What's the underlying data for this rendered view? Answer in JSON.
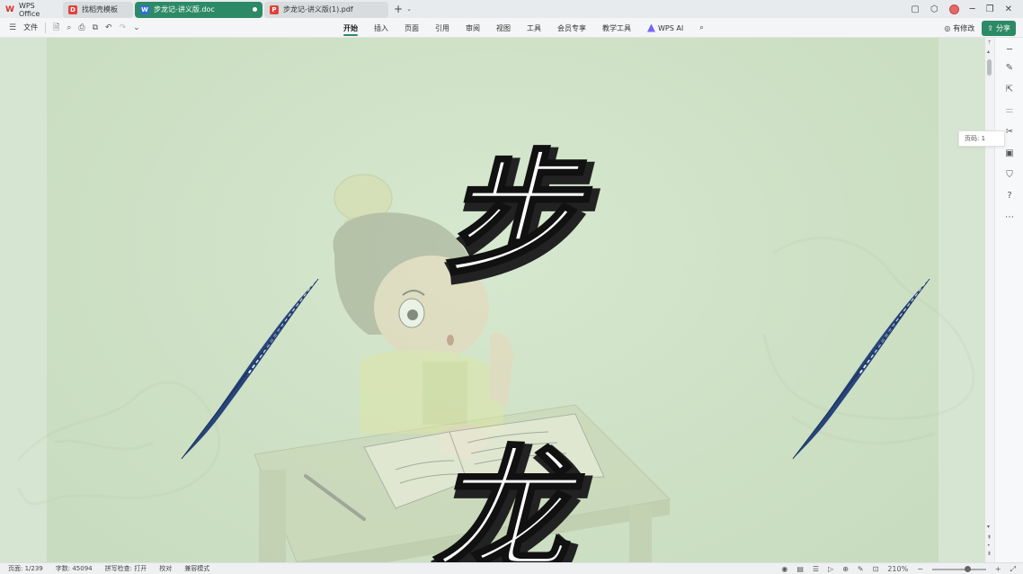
{
  "tabs": [
    {
      "label": "WPS Office"
    },
    {
      "label": "找稻壳模板"
    },
    {
      "label": "步龙记-讲义版.doc"
    },
    {
      "label": "步龙记-讲义版(1).pdf"
    }
  ],
  "toolbar": {
    "file_label": "文件",
    "menu": [
      "开始",
      "插入",
      "页面",
      "引用",
      "审阅",
      "视图",
      "工具",
      "会员专享",
      "教学工具",
      "WPS AI"
    ],
    "active_menu": "开始",
    "edit_label": "有修改",
    "share_label": "分享"
  },
  "document": {
    "title_chars": [
      "步",
      "龙"
    ]
  },
  "sidebar": {
    "page_tip": "页码: 1"
  },
  "statusbar": {
    "page": "页面: 1/239",
    "words": "字数: 45094",
    "spell": "拼写检查: 打开",
    "proof": "校对",
    "compat": "兼容模式",
    "zoom": "210%"
  },
  "colors": {
    "accent": "#2d8a66",
    "page_bg": "#cfe3c8"
  }
}
